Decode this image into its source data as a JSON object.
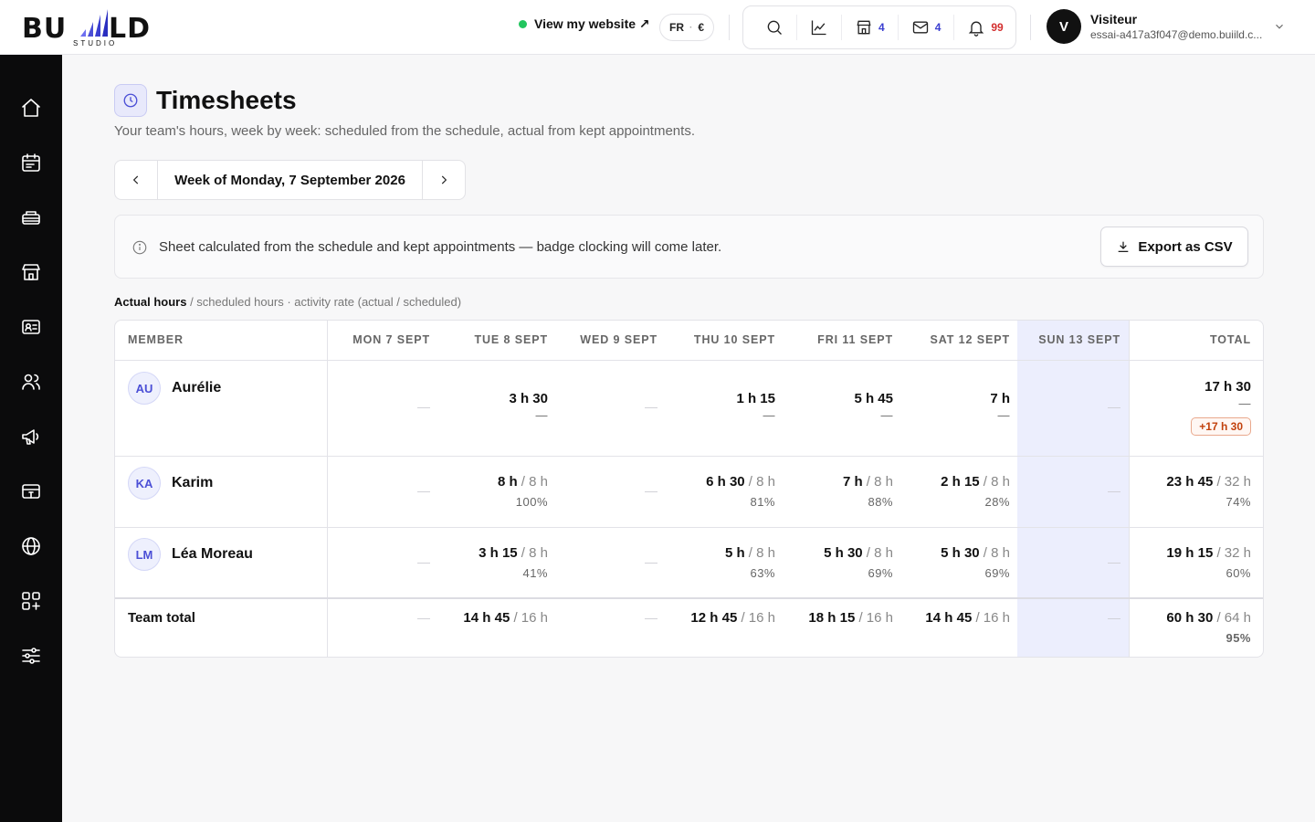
{
  "header": {
    "logo_text": "BUIILD",
    "logo_sub": "STUDIO",
    "view_site": "View my website ↗",
    "lang": "FR",
    "currency": "€",
    "counts": {
      "stores": "4",
      "mail": "4",
      "notifications": "99"
    },
    "user": {
      "initial": "V",
      "name": "Visiteur",
      "email": "essai-a417a3f047@demo.buiild.c..."
    }
  },
  "sidebar": [
    "home-icon",
    "calendar-icon",
    "services-icon",
    "store-icon",
    "contact-card-icon",
    "users-icon",
    "megaphone-icon",
    "payment-card-icon",
    "globe-icon",
    "apps-add-icon",
    "settings-sliders-icon"
  ],
  "page": {
    "title": "Timesheets",
    "subtitle": "Your team's hours, week by week: scheduled from the schedule, actual from kept appointments.",
    "week_label": "Week of Monday, 7 September 2026",
    "info": "Sheet calculated from the schedule and kept appointments — badge clocking will come later.",
    "export_label": "Export as CSV",
    "legend_bold": "Actual hours",
    "legend_rest": " / scheduled hours · activity rate (actual / scheduled)"
  },
  "table": {
    "headers": [
      "MEMBER",
      "MON 7 SEPT",
      "TUE 8 SEPT",
      "WED 9 SEPT",
      "THU 10 SEPT",
      "FRI 11 SEPT",
      "SAT 12 SEPT",
      "SUN 13 SEPT",
      "TOTAL"
    ],
    "highlight_color": "#eceefd",
    "rows": [
      {
        "initials": "AU",
        "name": "Aurélie",
        "days": [
          null,
          {
            "actual": "3 h 30",
            "scheduled": "",
            "rate": "—"
          },
          null,
          {
            "actual": "1 h 15",
            "scheduled": "",
            "rate": "—"
          },
          {
            "actual": "5 h 45",
            "scheduled": "",
            "rate": "—"
          },
          {
            "actual": "7 h",
            "scheduled": "",
            "rate": "—"
          },
          null
        ],
        "total": {
          "actual": "17 h 30",
          "scheduled": "",
          "rate": "—",
          "badge": "+17 h 30"
        }
      },
      {
        "initials": "KA",
        "name": "Karim",
        "days": [
          null,
          {
            "actual": "8 h",
            "scheduled": " / 8 h",
            "rate": "100%"
          },
          null,
          {
            "actual": "6 h 30",
            "scheduled": " / 8 h",
            "rate": "81%"
          },
          {
            "actual": "7 h",
            "scheduled": " / 8 h",
            "rate": "88%"
          },
          {
            "actual": "2 h 15",
            "scheduled": " / 8 h",
            "rate": "28%"
          },
          null
        ],
        "total": {
          "actual": "23 h 45",
          "scheduled": " / 32 h",
          "rate": "74%"
        }
      },
      {
        "initials": "LM",
        "name": "Léa Moreau",
        "days": [
          null,
          {
            "actual": "3 h 15",
            "scheduled": " / 8 h",
            "rate": "41%"
          },
          null,
          {
            "actual": "5 h",
            "scheduled": " / 8 h",
            "rate": "63%"
          },
          {
            "actual": "5 h 30",
            "scheduled": " / 8 h",
            "rate": "69%"
          },
          {
            "actual": "5 h 30",
            "scheduled": " / 8 h",
            "rate": "69%"
          },
          null
        ],
        "total": {
          "actual": "19 h 15",
          "scheduled": " / 32 h",
          "rate": "60%"
        }
      }
    ],
    "team_total": {
      "label": "Team total",
      "days": [
        null,
        {
          "actual": "14 h 45",
          "scheduled": " / 16 h"
        },
        null,
        {
          "actual": "12 h 45",
          "scheduled": " / 16 h"
        },
        {
          "actual": "18 h 15",
          "scheduled": " / 16 h"
        },
        {
          "actual": "14 h 45",
          "scheduled": " / 16 h"
        },
        null
      ],
      "total": {
        "actual": "60 h 30",
        "scheduled": " / 64 h",
        "rate": "95%"
      }
    }
  }
}
